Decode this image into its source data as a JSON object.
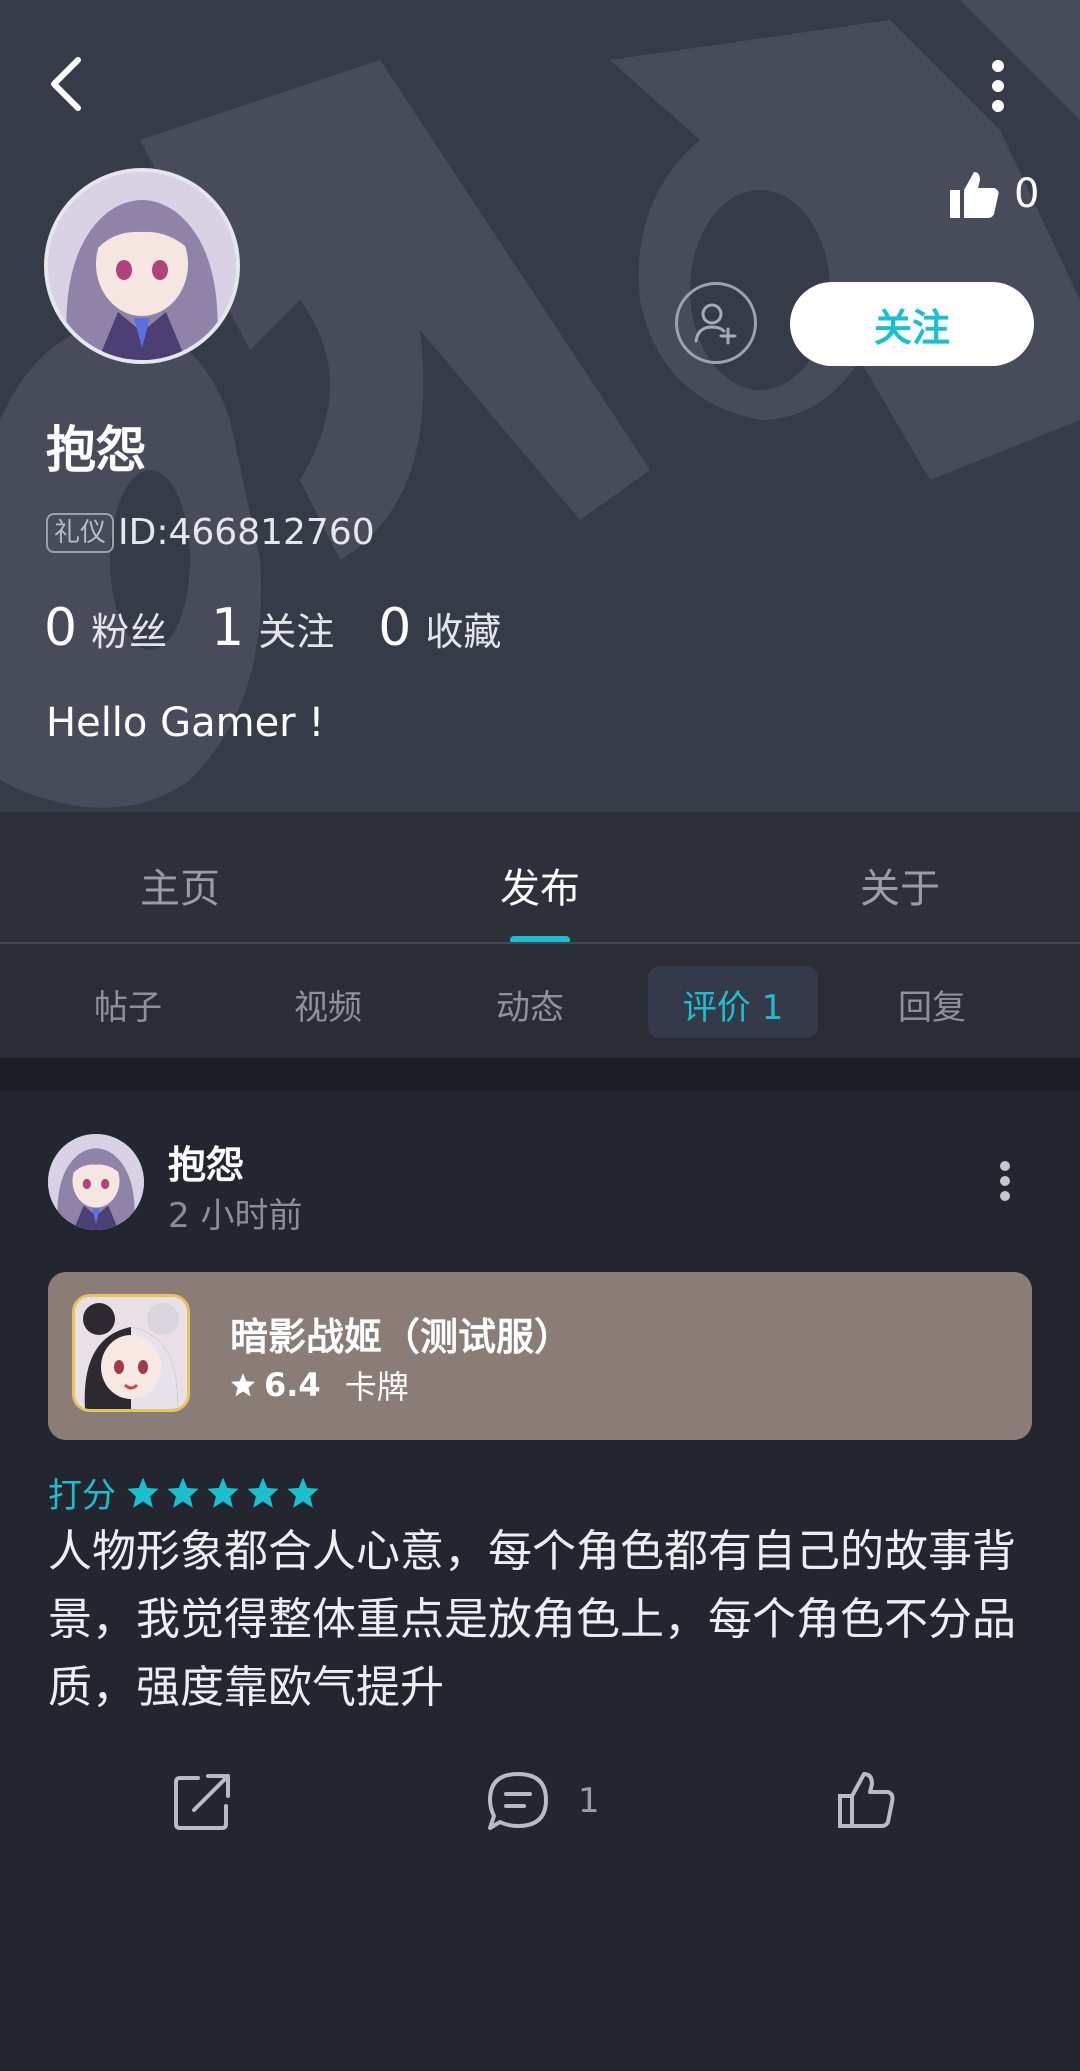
{
  "profile": {
    "name": "抱怨",
    "badge": "礼仪",
    "id_text": "ID:466812760",
    "like_count": "0",
    "follow_label": "关注",
    "bio": "Hello Gamer !",
    "stats": [
      {
        "num": "0",
        "label": "粉丝"
      },
      {
        "num": "1",
        "label": "关注"
      },
      {
        "num": "0",
        "label": "收藏"
      }
    ]
  },
  "tabs": [
    "主页",
    "发布",
    "关于"
  ],
  "active_tab": "发布",
  "subtabs": [
    "帖子",
    "视频",
    "动态",
    "评价 1",
    "回复"
  ],
  "active_subtab": "评价 1",
  "post": {
    "author": "抱怨",
    "time": "2 小时前",
    "game": {
      "title": "暗影战姬（测试服）",
      "score": "6.4",
      "genre": "卡牌"
    },
    "rating_label": "打分",
    "stars": 5,
    "review": "人物形象都合人心意，每个角色都有自己的故事背景，我觉得整体重点是放角色上，每个角色不分品质，强度靠欧气提升",
    "comment_count": "1"
  },
  "colors": {
    "accent": "#1cbfcf",
    "header_bg": "#363b48",
    "page_bg": "#23252f",
    "game_card_bg": "#8a7c77"
  }
}
